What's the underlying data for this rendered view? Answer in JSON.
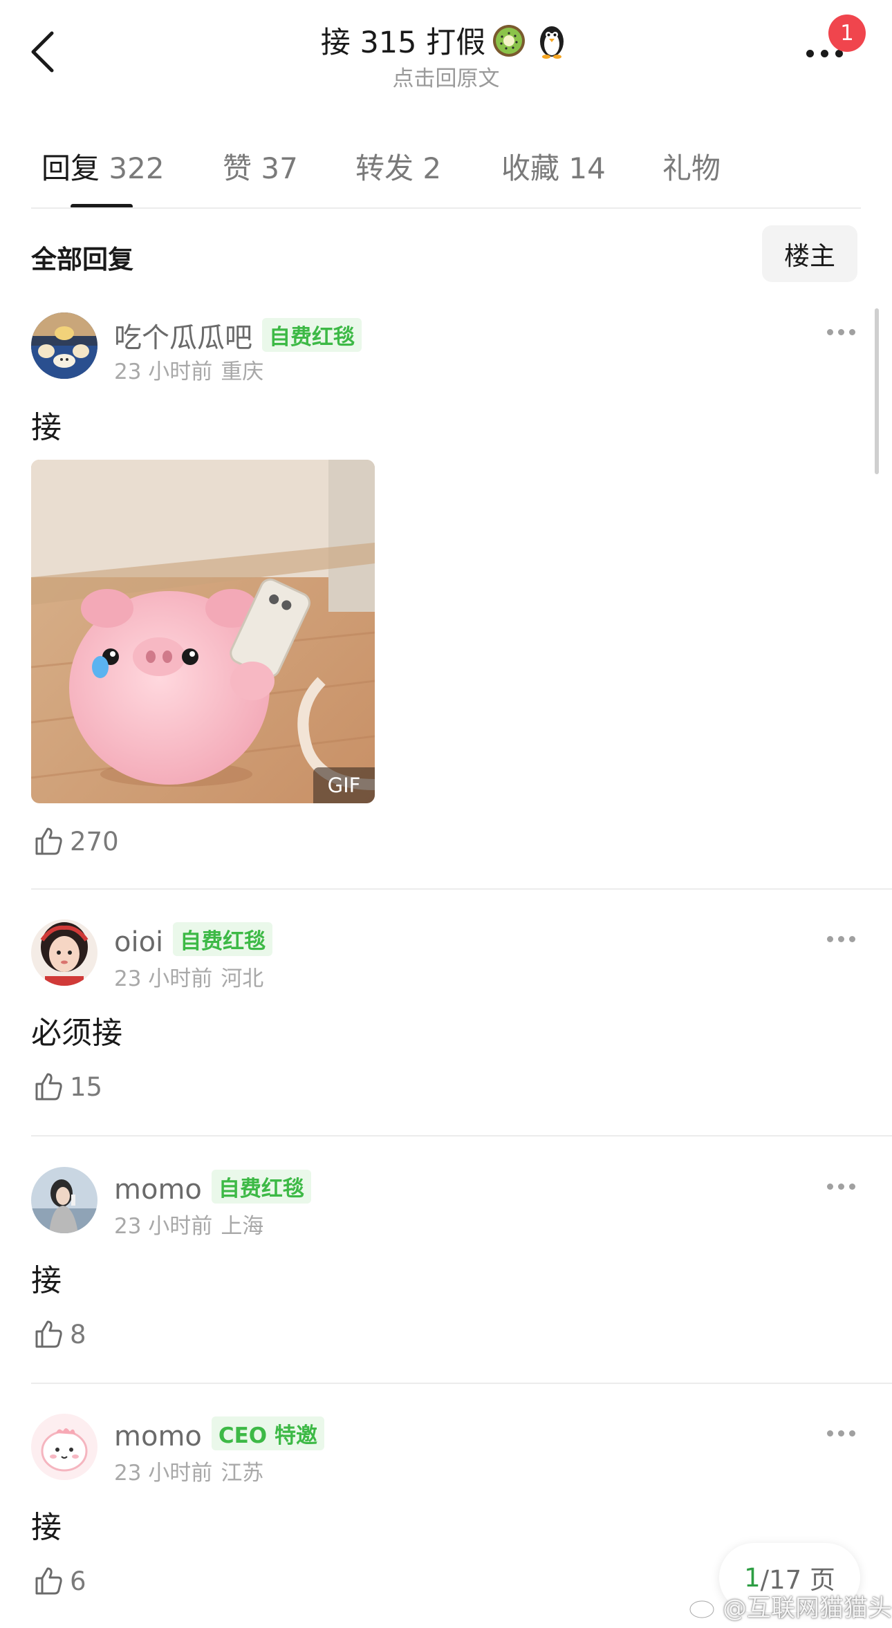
{
  "header": {
    "title": "接 315 打假",
    "emojis": [
      "kiwi-icon",
      "penguin-icon"
    ],
    "subtitle": "点击回原文",
    "badge_count": "1"
  },
  "tabs": [
    {
      "label": "回复",
      "count": "322",
      "active": true
    },
    {
      "label": "赞",
      "count": "37",
      "active": false
    },
    {
      "label": "转发",
      "count": "2",
      "active": false
    },
    {
      "label": "收藏",
      "count": "14",
      "active": false
    },
    {
      "label": "礼物",
      "count": "",
      "active": false
    }
  ],
  "filter": {
    "title": "全部回复",
    "op_button": "楼主"
  },
  "comments": [
    {
      "username": "吃个瓜瓜吧",
      "tag": "自费红毯",
      "time": "23 小时前",
      "location": "重庆",
      "text": "接",
      "has_gif": true,
      "gif_label": "GIF",
      "likes": "270"
    },
    {
      "username": "oioi",
      "tag": "自费红毯",
      "time": "23 小时前",
      "location": "河北",
      "text": "必须接",
      "likes": "15"
    },
    {
      "username": "momo",
      "tag": "自费红毯",
      "time": "23 小时前",
      "location": "上海",
      "text": "接",
      "likes": "8"
    },
    {
      "username": "momo",
      "tag": "CEO 特邀",
      "time": "23 小时前",
      "location": "江苏",
      "text": "接",
      "likes": "6"
    }
  ],
  "pagination": {
    "current": "1",
    "total_text": "/17 页"
  },
  "watermark": {
    "text": "@互联网猫猫头"
  },
  "colors": {
    "accent_green": "#3db946",
    "badge_red": "#f0454d",
    "page_green": "#2e9e44"
  }
}
